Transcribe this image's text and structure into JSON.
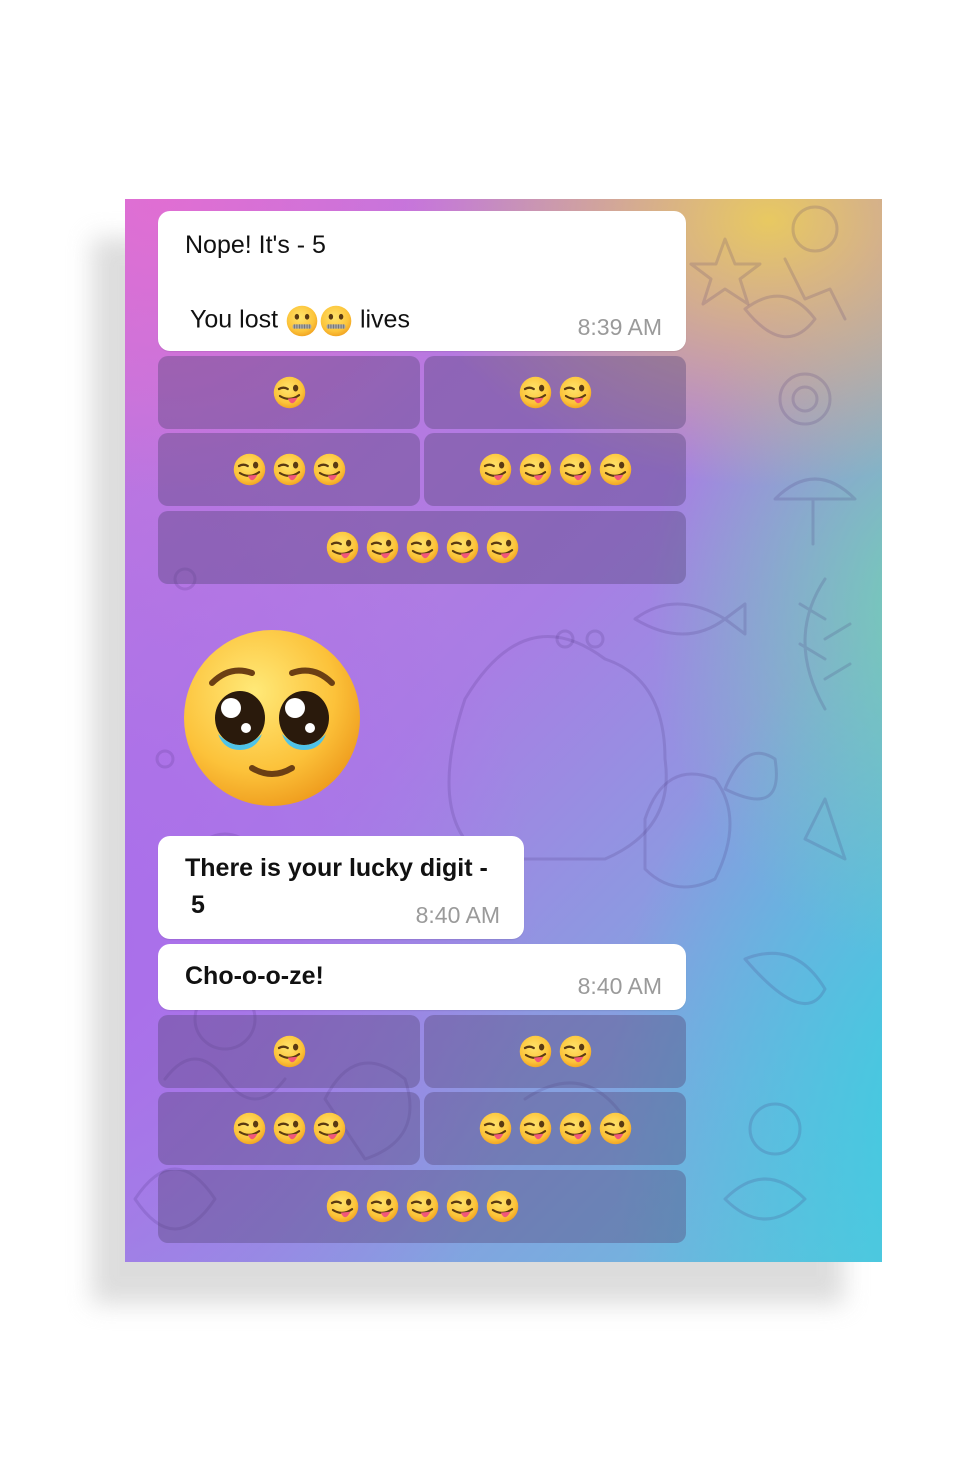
{
  "messages": {
    "m1": {
      "line1": "Nope! It's - 5",
      "line2_prefix": "You lost",
      "line2_suffix": "lives",
      "inline_icons": [
        "zipper-mouth-face-icon",
        "zipper-mouth-face-icon"
      ],
      "time": "8:39 AM"
    },
    "m2": {
      "text_line1": "There is your lucky digit -",
      "text_line2": "5",
      "time": "8:40 AM"
    },
    "m3": {
      "text": "Cho-o-o-ze!",
      "time": "8:40 AM"
    }
  },
  "keyboard_1": {
    "buttons": [
      {
        "icon": "winking-tongue-face-icon",
        "count": 1
      },
      {
        "icon": "winking-tongue-face-icon",
        "count": 2
      },
      {
        "icon": "winking-tongue-face-icon",
        "count": 3
      },
      {
        "icon": "winking-tongue-face-icon",
        "count": 4
      },
      {
        "icon": "winking-tongue-face-icon",
        "count": 5
      }
    ]
  },
  "keyboard_2": {
    "buttons": [
      {
        "icon": "winking-tongue-face-icon",
        "count": 1
      },
      {
        "icon": "winking-tongue-face-icon",
        "count": 2
      },
      {
        "icon": "winking-tongue-face-icon",
        "count": 3
      },
      {
        "icon": "winking-tongue-face-icon",
        "count": 4
      },
      {
        "icon": "winking-tongue-face-icon",
        "count": 5
      }
    ]
  },
  "sticker": {
    "icon": "pleading-face-icon"
  },
  "colors": {
    "bubble_bg": "#ffffff",
    "time_text": "#9a9a9a",
    "keyboard_button_bg": "rgba(85,70,120,0.40)",
    "wallpaper": [
      "#c974dc",
      "#ebcd5a",
      "#6ed7af",
      "#3ccde1",
      "#aa6eeb"
    ]
  }
}
